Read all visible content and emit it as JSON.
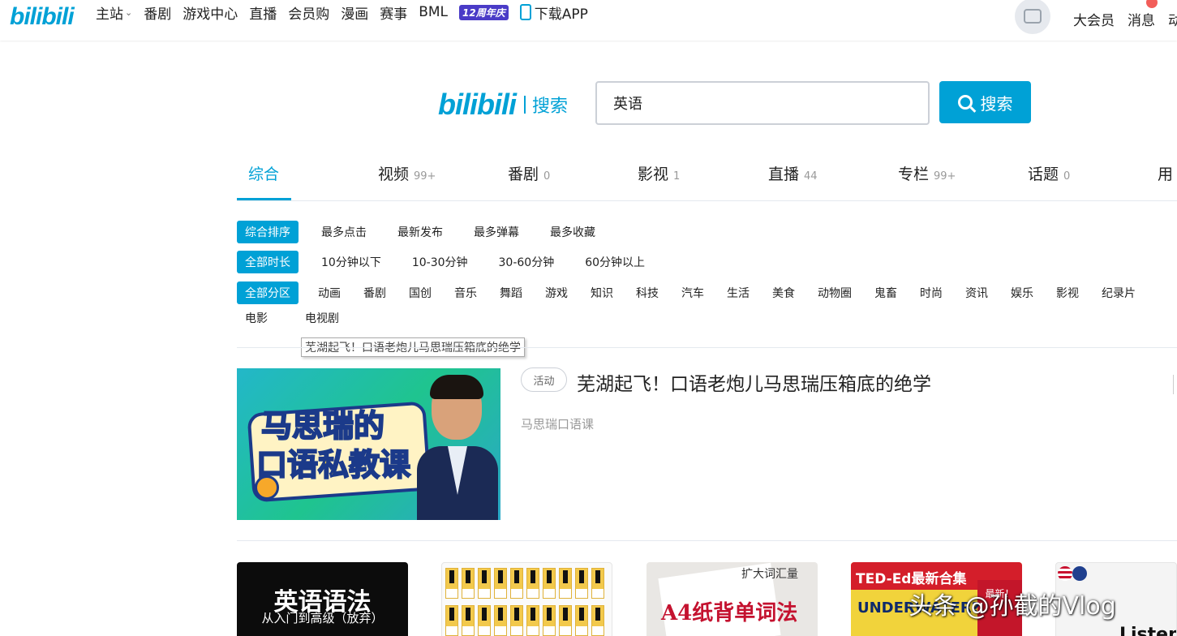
{
  "topbar": {
    "logo": "bilibili",
    "nav": [
      "主站",
      "番剧",
      "游戏中心",
      "直播",
      "会员购",
      "漫画",
      "赛事",
      "BML"
    ],
    "anniversary": "12周年庆",
    "download": "下载APP",
    "right": [
      "大会员",
      "消息",
      "动"
    ]
  },
  "search": {
    "logo": "bilibili",
    "logo_text": "搜索",
    "query": "英语",
    "button": "搜索"
  },
  "tabs": [
    {
      "label": "综合",
      "count": ""
    },
    {
      "label": "视频",
      "count": "99+"
    },
    {
      "label": "番剧",
      "count": "0"
    },
    {
      "label": "影视",
      "count": "1"
    },
    {
      "label": "直播",
      "count": "44"
    },
    {
      "label": "专栏",
      "count": "99+"
    },
    {
      "label": "话题",
      "count": "0"
    },
    {
      "label": "用",
      "count": ""
    }
  ],
  "filters": {
    "order": [
      "综合排序",
      "最多点击",
      "最新发布",
      "最多弹幕",
      "最多收藏"
    ],
    "duration": [
      "全部时长",
      "10分钟以下",
      "10-30分钟",
      "30-60分钟",
      "60分钟以上"
    ],
    "zone": [
      "全部分区",
      "动画",
      "番剧",
      "国创",
      "音乐",
      "舞蹈",
      "游戏",
      "知识",
      "科技",
      "汽车",
      "生活",
      "美食",
      "动物圈",
      "鬼畜",
      "时尚",
      "资讯",
      "娱乐",
      "影视",
      "纪录片"
    ],
    "zone_row2": [
      "电影",
      "电视剧"
    ]
  },
  "tooltip": "芜湖起飞！口语老炮儿马思瑞压箱底的绝学",
  "feature": {
    "tag": "活动",
    "title": "芜湖起飞！口语老炮儿马思瑞压箱底的绝学",
    "subtitle": "马思瑞口语课",
    "thumb_line1": "马思瑞的",
    "thumb_line2": "口语私教课"
  },
  "cards": {
    "c1_big": "英语语法",
    "c1_small": "从入门到高级（放弃）",
    "c3_tag": "扩大词汇量",
    "c3_big": "A4纸背单词法",
    "c4_title": "TED-Ed最新合集",
    "c4_mid": "UNDERWATER?",
    "c4_corner": "最新！",
    "c5_text": "Listen"
  },
  "watermark": "头条 @孙截的Vlog",
  "colors": {
    "accent": "#00a1d6",
    "badge": "#f25d59"
  }
}
